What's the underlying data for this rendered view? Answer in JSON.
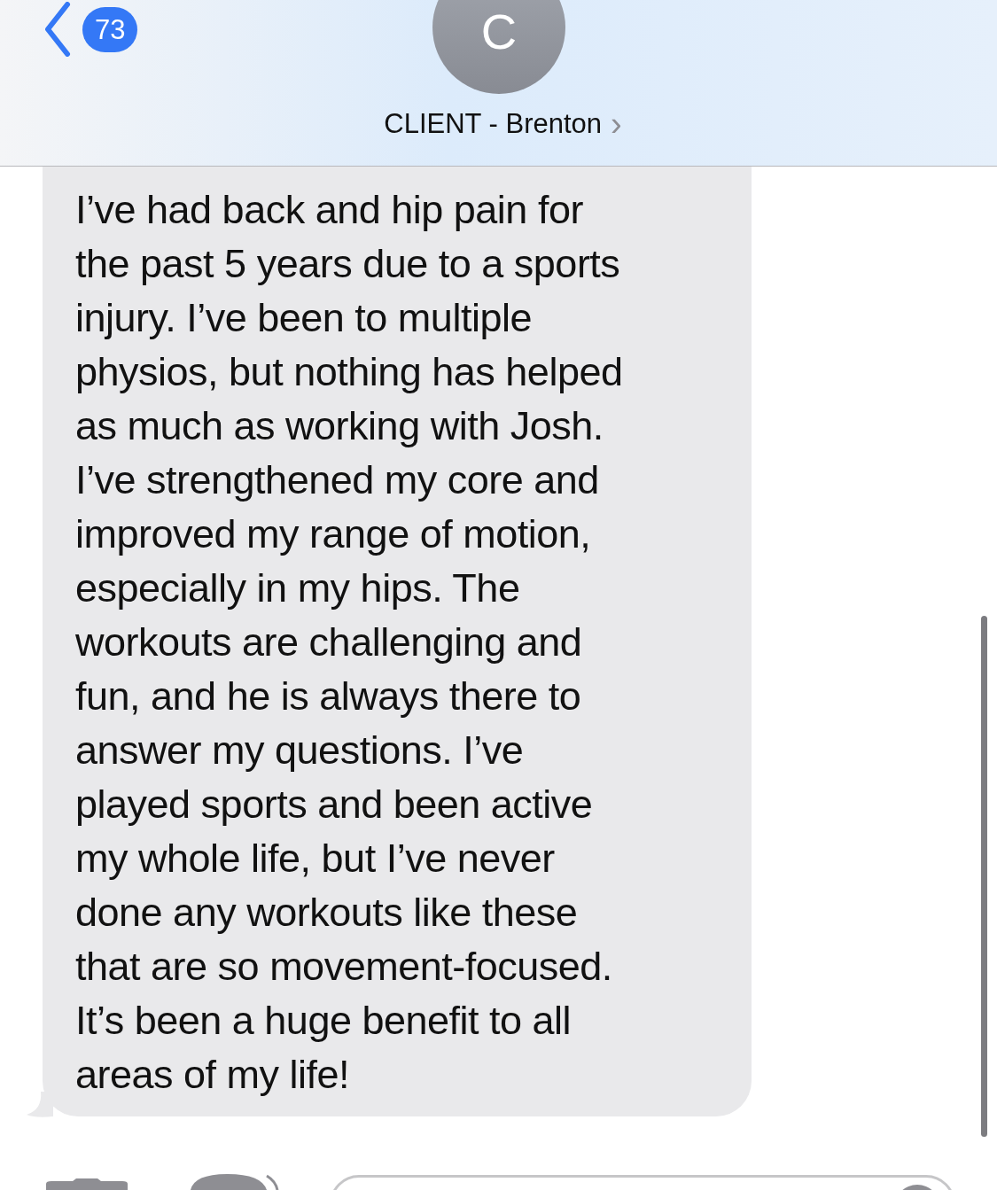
{
  "header": {
    "unread_count": "73",
    "avatar_initial": "C",
    "contact_name": "CLIENT - Brenton",
    "chevron": "›"
  },
  "messages": [
    {
      "text": "I’ve had back and hip pain for\nthe past 5 years due to a sports\ninjury. I’ve been to multiple\nphysios, but nothing has helped\nas much as working with Josh.\nI’ve strengthened my core and\nimproved my range of motion,\nespecially in my hips. The\nworkouts are challenging and\nfun, and he is always there to\nanswer my questions. I’ve\nplayed sports and been active\nmy whole life, but I’ve never\ndone any workouts like these\nthat are so movement-focused.\nIt’s been a huge benefit to all\nareas of my life!"
    }
  ]
}
